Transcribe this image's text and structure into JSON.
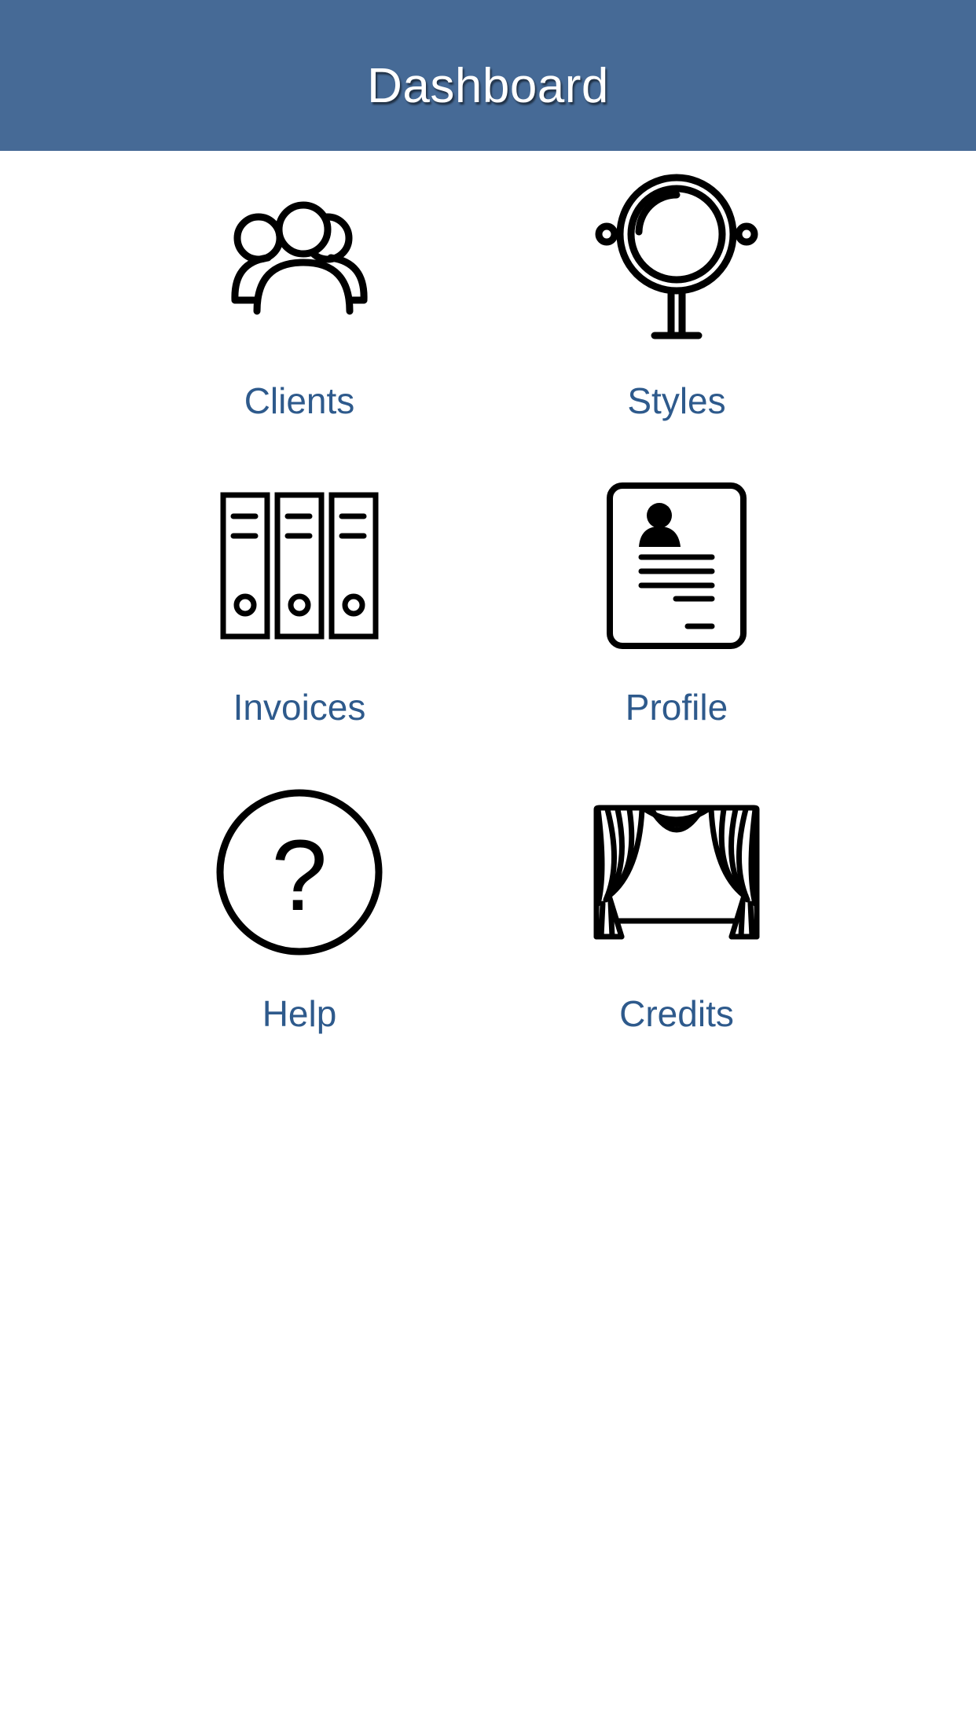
{
  "header": {
    "title": "Dashboard"
  },
  "colors": {
    "header_bg": "#466a96",
    "label": "#2e5a8c",
    "background": "#ffffff",
    "icon_stroke": "#000000"
  },
  "tiles": [
    {
      "label": "Clients",
      "icon": "users-group-icon"
    },
    {
      "label": "Styles",
      "icon": "vanity-mirror-icon"
    },
    {
      "label": "Invoices",
      "icon": "binders-icon"
    },
    {
      "label": "Profile",
      "icon": "profile-card-icon"
    },
    {
      "label": "Help",
      "icon": "help-circle-icon"
    },
    {
      "label": "Credits",
      "icon": "stage-curtain-icon"
    }
  ]
}
